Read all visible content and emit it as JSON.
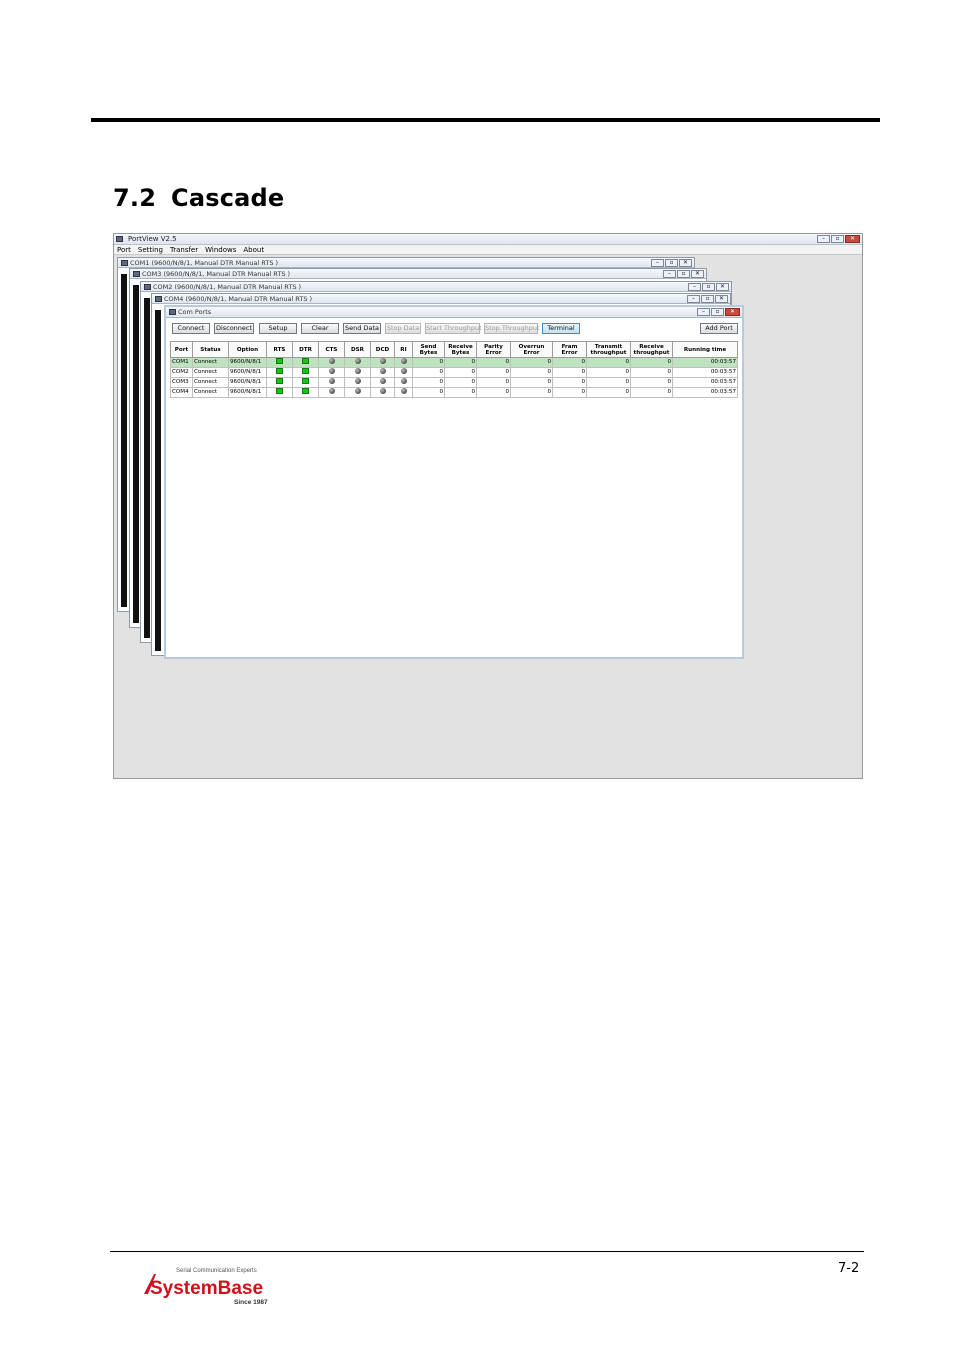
{
  "section": {
    "number": "7.2",
    "title": "Cascade"
  },
  "app": {
    "title": "PortView V2.5",
    "menu": [
      "Port",
      "Setting",
      "Transfer",
      "Windows",
      "About"
    ],
    "cascade_windows": [
      "COM1 (9600/N/8/1, Manual DTR Manual RTS )",
      "COM3 (9600/N/8/1, Manual DTR Manual RTS )",
      "COM2 (9600/N/8/1, Manual DTR Manual RTS )",
      "COM4 (9600/N/8/1, Manual DTR Manual RTS )"
    ],
    "front_window": {
      "title": "Com Ports",
      "toolbar": [
        "Connect",
        "Disconnect",
        "Setup",
        "Clear",
        "Send Data",
        "Stop Data",
        "Start Throughput",
        "Stop Throughput",
        "Terminal"
      ],
      "add_port": "Add Port",
      "columns": [
        "Port",
        "Status",
        "Option",
        "RTS",
        "DTR",
        "CTS",
        "DSR",
        "DCD",
        "RI",
        "Send Bytes",
        "Receive Bytes",
        "Parity Error",
        "Overrun Error",
        "Fram Error",
        "Transmit throughput",
        "Receive throughput",
        "Running time"
      ],
      "rows": [
        {
          "port": "COM1",
          "status": "Connect",
          "option": "9600/N/8/1",
          "send": "0",
          "recv": "0",
          "parity": "0",
          "overrun": "0",
          "fram": "0",
          "tx": "0",
          "rx": "0",
          "time": "00:03:57"
        },
        {
          "port": "COM2",
          "status": "Connect",
          "option": "9600/N/8/1",
          "send": "0",
          "recv": "0",
          "parity": "0",
          "overrun": "0",
          "fram": "0",
          "tx": "0",
          "rx": "0",
          "time": "00:03:57"
        },
        {
          "port": "COM3",
          "status": "Connect",
          "option": "9600/N/8/1",
          "send": "0",
          "recv": "0",
          "parity": "0",
          "overrun": "0",
          "fram": "0",
          "tx": "0",
          "rx": "0",
          "time": "00:03:57"
        },
        {
          "port": "COM4",
          "status": "Connect",
          "option": "9600/N/8/1",
          "send": "0",
          "recv": "0",
          "parity": "0",
          "overrun": "0",
          "fram": "0",
          "tx": "0",
          "rx": "0",
          "time": "00:03:57"
        }
      ]
    }
  },
  "footer": {
    "page": "7-2",
    "logo_tagline": "Serial Communication Experts",
    "logo_name": "SystemBase",
    "logo_since": "Since 1987"
  },
  "colors": {
    "led_on": "#18c418",
    "logo_red": "#d0101b",
    "selected_row": "#bfe3bf"
  }
}
